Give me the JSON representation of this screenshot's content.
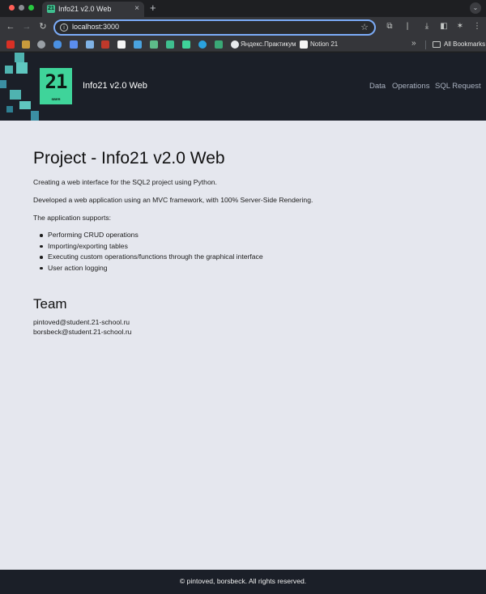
{
  "browser": {
    "tab_title": "Info21 v2.0 Web",
    "tab_close_icon": "close-icon",
    "new_tab_icon": "plus-icon",
    "url": "localhost:3000",
    "bookmarks": [
      {
        "label": "Яндекс.Практикум"
      },
      {
        "label": "Notion 21"
      },
      {
        "label": "All Bookmarks"
      }
    ]
  },
  "header": {
    "logo_text": "21",
    "logo_subtext": "SBER",
    "brand": "Info21 v2.0 Web",
    "nav": [
      "Data",
      "Operations",
      "SQL Request"
    ]
  },
  "main": {
    "title": "Project - Info21 v2.0 Web",
    "paragraphs": [
      "Creating a web interface for the SQL2 project using Python.",
      "Developed a web application using an MVC framework, with 100% Server-Side Rendering.",
      "The application supports:"
    ],
    "features": [
      "Performing CRUD operations",
      "Importing/exporting tables",
      "Executing custom operations/functions through the graphical interface",
      "User action logging"
    ],
    "team_title": "Team",
    "team": [
      "pintoved@student.21-school.ru",
      "borsbeck@student.21-school.ru"
    ]
  },
  "footer": {
    "text": "© pintoved, borsbeck. All rights reserved."
  },
  "colors": {
    "header_bg": "#1b1f28",
    "page_bg": "#e5e7ee",
    "logo_green": "#3fd49a",
    "nav_link": "#aab2c0"
  }
}
